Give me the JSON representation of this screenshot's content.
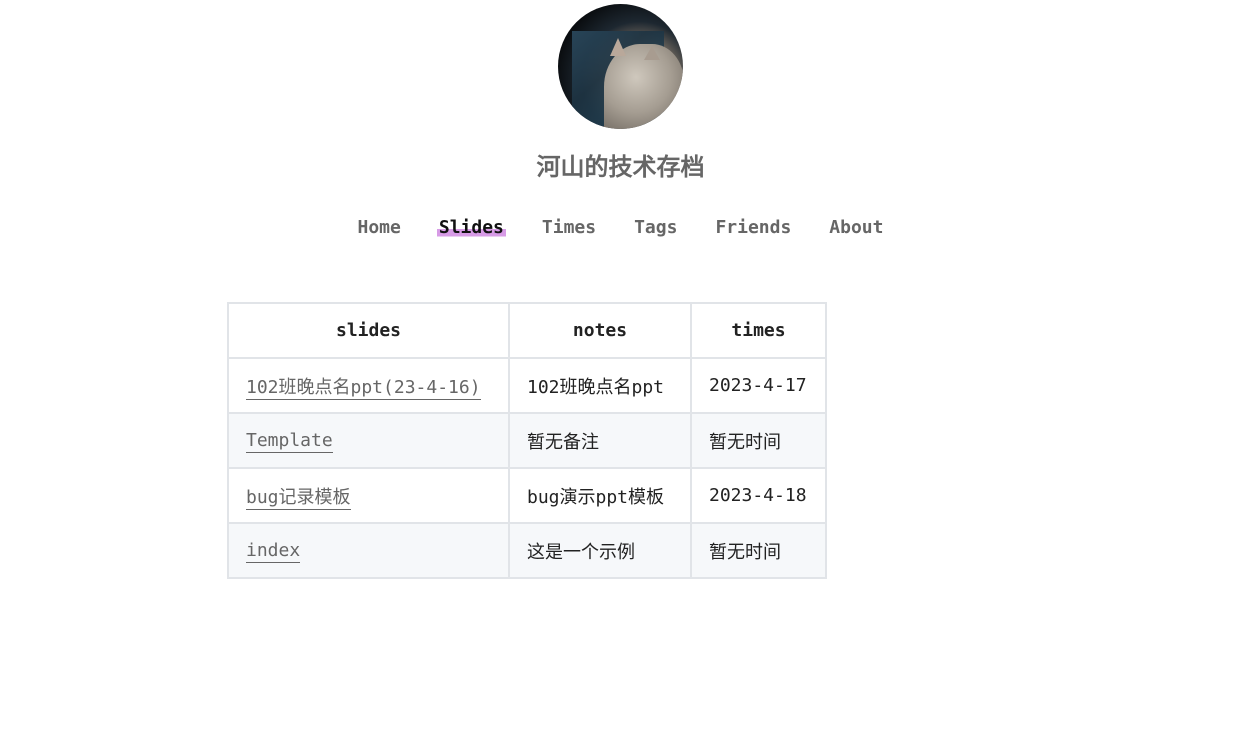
{
  "site": {
    "avatar_alt": "cat looking at code on a monitor",
    "title": "河山的技术存档"
  },
  "nav": {
    "items": [
      {
        "label": "Home",
        "active": false
      },
      {
        "label": "Slides",
        "active": true
      },
      {
        "label": "Times",
        "active": false
      },
      {
        "label": "Tags",
        "active": false
      },
      {
        "label": "Friends",
        "active": false
      },
      {
        "label": "About",
        "active": false
      }
    ],
    "active_highlight_color": "#d79be6"
  },
  "table": {
    "headers": [
      "slides",
      "notes",
      "times"
    ],
    "rows": [
      {
        "slide": "102班晚点名ppt(23-4-16)",
        "notes": "102班晚点名ppt",
        "times": "2023-4-17"
      },
      {
        "slide": "Template",
        "notes": "暂无备注",
        "times": "暂无时间"
      },
      {
        "slide": "bug记录模板",
        "notes": "bug演示ppt模板",
        "times": "2023-4-18"
      },
      {
        "slide": "index",
        "notes": "这是一个示例",
        "times": "暂无时间"
      }
    ]
  }
}
